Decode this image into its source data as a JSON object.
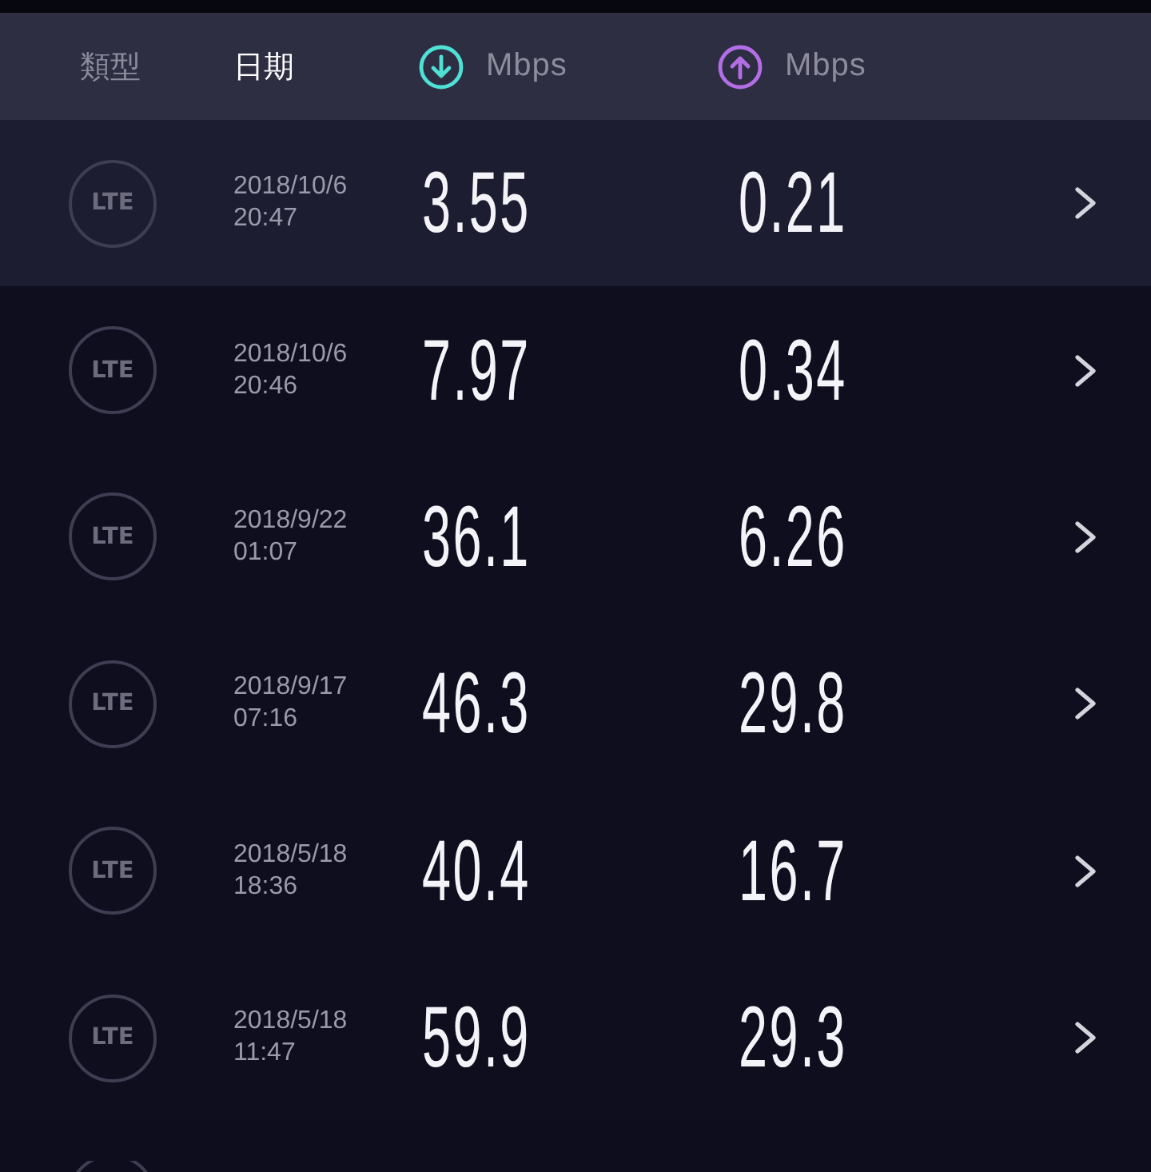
{
  "header": {
    "columns": [
      {
        "kind": "text",
        "label": "類型",
        "selected": false
      },
      {
        "kind": "text",
        "label": "日期",
        "selected": true
      },
      {
        "kind": "download",
        "label": "Mbps",
        "selected": false,
        "color": "#4fe0d6"
      },
      {
        "kind": "upload",
        "label": "Mbps",
        "selected": false,
        "color": "#b36ee6"
      }
    ]
  },
  "rows": [
    {
      "network": "LTE",
      "date": "2018/10/6",
      "time": "20:47",
      "download": "3.55",
      "upload": "0.21",
      "selected": true
    },
    {
      "network": "LTE",
      "date": "2018/10/6",
      "time": "20:46",
      "download": "7.97",
      "upload": "0.34",
      "selected": false
    },
    {
      "network": "LTE",
      "date": "2018/9/22",
      "time": "01:07",
      "download": "36.1",
      "upload": "6.26",
      "selected": false
    },
    {
      "network": "LTE",
      "date": "2018/9/17",
      "time": "07:16",
      "download": "46.3",
      "upload": "29.8",
      "selected": false
    },
    {
      "network": "LTE",
      "date": "2018/5/18",
      "time": "18:36",
      "download": "40.4",
      "upload": "16.7",
      "selected": false
    },
    {
      "network": "LTE",
      "date": "2018/5/18",
      "time": "11:47",
      "download": "59.9",
      "upload": "29.3",
      "selected": false
    }
  ],
  "more_below": true
}
